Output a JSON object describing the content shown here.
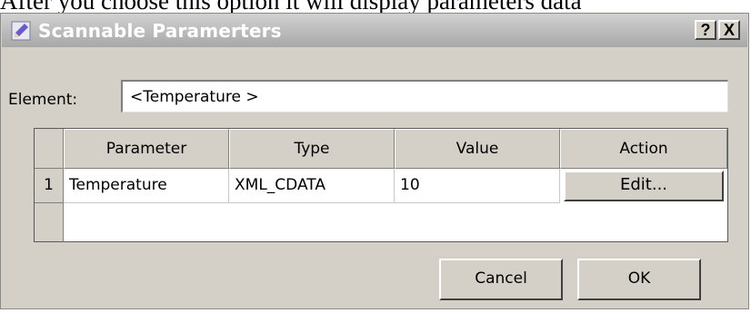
{
  "background_caption": "After you choose this option it will display parameters data",
  "window": {
    "title": "Scannable Paramerters",
    "help_button": "?",
    "close_button": "X",
    "icon": "pencil-icon"
  },
  "element": {
    "label": "Element:",
    "value": "<Temperature >"
  },
  "table": {
    "columns": [
      "Parameter",
      "Type",
      "Value",
      "Action"
    ],
    "rows": [
      {
        "index": "1",
        "parameter": "Temperature",
        "type": "XML_CDATA",
        "value": "10",
        "action": "Edit..."
      }
    ]
  },
  "buttons": {
    "cancel": "Cancel",
    "ok": "OK"
  }
}
